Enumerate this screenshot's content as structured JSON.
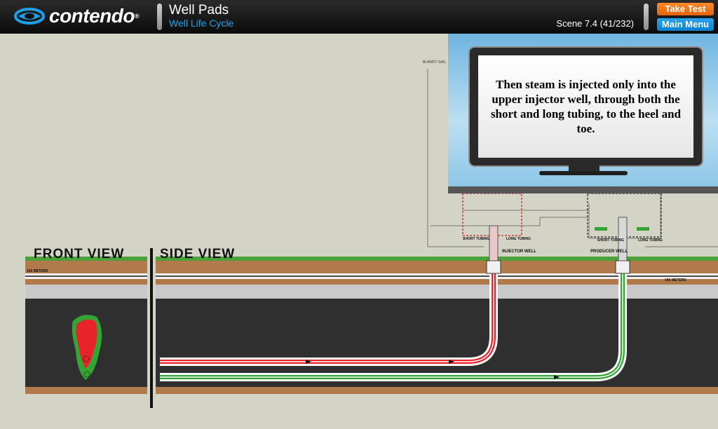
{
  "header": {
    "logo_text": "contendo",
    "logo_reg": "®",
    "title": "Well Pads",
    "subtitle": "Well Life Cycle",
    "scene_label": "Scene 7.4 (41/232)",
    "take_test_label": "Take Test",
    "main_menu_label": "Main Menu"
  },
  "monitor": {
    "text": "Then steam is injected only into the upper injector well, through both the short and long tubing, to the heel and toe."
  },
  "diagram": {
    "front_view_label": "FRONT VIEW",
    "side_view_label": "SIDE VIEW",
    "depth_label_left": "100 METERS",
    "depth_label_right": "100 METERS",
    "blowdown_label": "BLAWDT GAS",
    "injector_well_label": "INJECTOR WELL",
    "producer_well_label": "PRODUCER WELL",
    "short_tubing_label": "SHORT TUBING",
    "long_tubing_label": "LONG TUBING",
    "colors": {
      "steam": "#e8232b",
      "production": "#34a534",
      "overburden": "#2f2f2f",
      "soil": "#b07a4a",
      "grass": "#4da13b"
    }
  }
}
